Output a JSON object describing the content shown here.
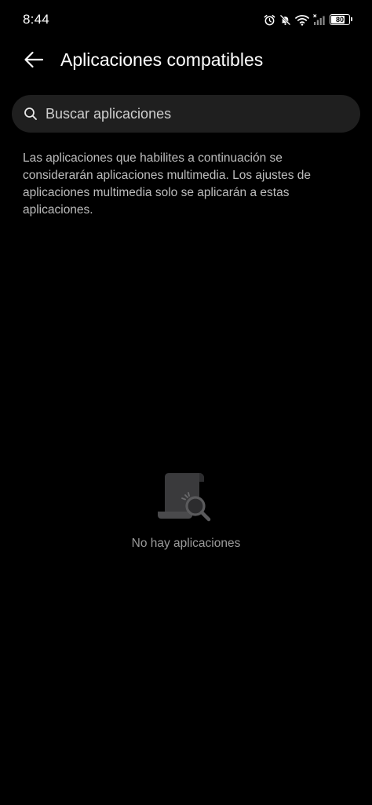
{
  "status_bar": {
    "time": "8:44",
    "battery_level": "80",
    "icons": [
      "alarm-icon",
      "mute-icon",
      "wifi-icon",
      "signal-icon",
      "battery-icon"
    ]
  },
  "header": {
    "back_icon": "arrow-left-icon",
    "title": "Aplicaciones compatibles"
  },
  "search": {
    "icon": "search-icon",
    "placeholder": "Buscar aplicaciones",
    "value": ""
  },
  "description": "Las aplicaciones que habilites a continuación se considerarán aplicaciones multimedia. Los ajustes de aplicaciones multimedia solo se aplicarán a estas aplicaciones.",
  "empty_state": {
    "icon": "document-search-icon",
    "message": "No hay aplicaciones"
  },
  "colors": {
    "background": "#000000",
    "search_background": "#1f1f1f",
    "description_text": "#bdbdbd",
    "empty_text": "#9a9a9a"
  }
}
